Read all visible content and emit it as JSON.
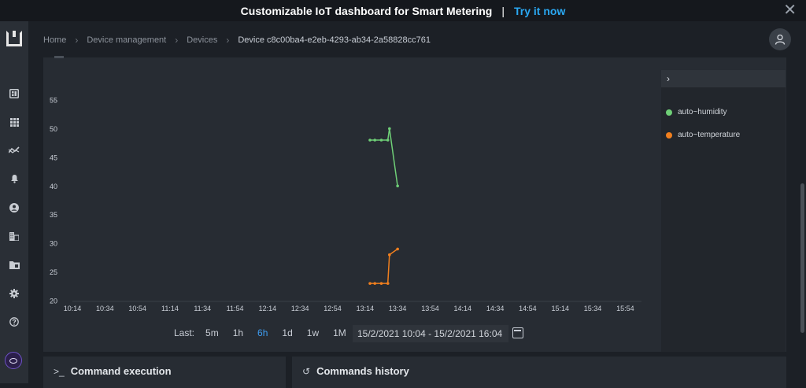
{
  "banner": {
    "title": "Customizable IoT dashboard for Smart Metering",
    "separator": "|",
    "cta": "Try it now",
    "close": "✕"
  },
  "sidebar": {
    "icons": [
      "dashboard-icon",
      "apps-grid-icon",
      "analytics-icon",
      "bell-icon",
      "user-icon",
      "building-icon",
      "folder-icon",
      "gear-icon",
      "help-icon"
    ],
    "chat_icon": "chat-bubble-icon"
  },
  "breadcrumb": {
    "items": [
      "Home",
      "Device management",
      "Devices"
    ],
    "current": "Device c8c00ba4-e2eb-4293-ab34-2a58828cc761",
    "chevron": "›"
  },
  "legend": {
    "toggle": "›",
    "items": [
      {
        "label": "auto~humidity",
        "color": "#6fcf77"
      },
      {
        "label": "auto~temperature",
        "color": "#f07f1e"
      }
    ]
  },
  "time_range": {
    "label": "Last:",
    "options": [
      "5m",
      "1h",
      "6h",
      "1d",
      "1w",
      "1M"
    ],
    "active": "6h",
    "date_range": "15/2/2021 10:04 - 15/2/2021 16:04"
  },
  "cards": {
    "command_execution": {
      "title": "Command execution",
      "icon": ">_"
    },
    "commands_history": {
      "title": "Commands history",
      "icon": "↺"
    }
  },
  "chart_data": {
    "type": "line",
    "title": "",
    "xlabel": "",
    "ylabel": "",
    "ylim": [
      20,
      55
    ],
    "y_ticks": [
      20,
      25,
      30,
      35,
      40,
      45,
      50,
      55
    ],
    "x_ticks": [
      "10:14",
      "10:34",
      "10:54",
      "11:14",
      "11:34",
      "11:54",
      "12:14",
      "12:34",
      "12:54",
      "13:14",
      "13:34",
      "13:54",
      "14:14",
      "14:34",
      "14:54",
      "15:14",
      "15:34",
      "15:54"
    ],
    "x_range_minutes": [
      614,
      964
    ],
    "grid": false,
    "legend_position": "right",
    "series": [
      {
        "name": "auto~humidity",
        "color": "#6fcf77",
        "points": [
          {
            "t": 797,
            "y": 48
          },
          {
            "t": 800,
            "y": 48
          },
          {
            "t": 804,
            "y": 48
          },
          {
            "t": 808,
            "y": 48
          },
          {
            "t": 809,
            "y": 50
          },
          {
            "t": 814,
            "y": 40
          }
        ]
      },
      {
        "name": "auto~temperature",
        "color": "#f07f1e",
        "points": [
          {
            "t": 797,
            "y": 23
          },
          {
            "t": 800,
            "y": 23
          },
          {
            "t": 804,
            "y": 23
          },
          {
            "t": 808,
            "y": 23
          },
          {
            "t": 809,
            "y": 28
          },
          {
            "t": 814,
            "y": 29
          }
        ]
      }
    ]
  }
}
